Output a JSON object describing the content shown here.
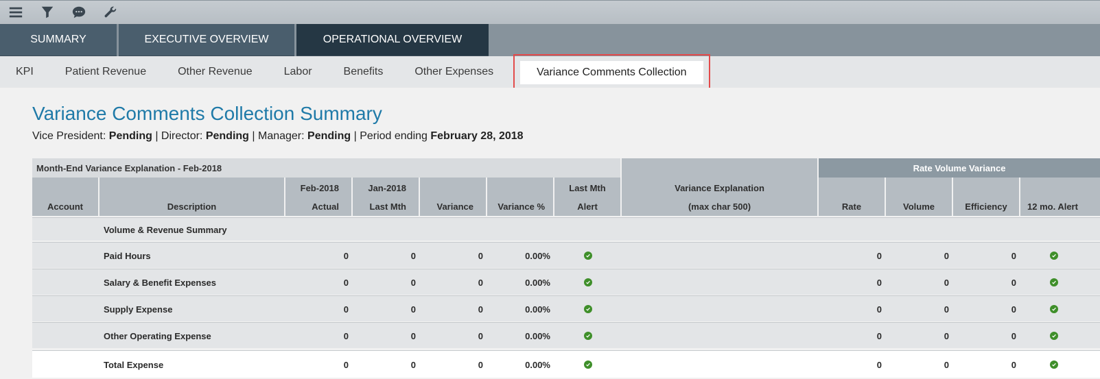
{
  "toolbar": {
    "icons": [
      "menu-icon",
      "filter-icon",
      "chat-icon",
      "wrench-icon"
    ]
  },
  "main_tabs": [
    {
      "label": "SUMMARY",
      "active": false
    },
    {
      "label": "EXECUTIVE OVERVIEW",
      "active": false
    },
    {
      "label": "OPERATIONAL OVERVIEW",
      "active": true
    }
  ],
  "sub_tabs": [
    {
      "label": "KPI"
    },
    {
      "label": "Patient Revenue"
    },
    {
      "label": "Other Revenue"
    },
    {
      "label": "Labor"
    },
    {
      "label": "Benefits"
    },
    {
      "label": "Other Expenses"
    },
    {
      "label": "Variance Comments Collection",
      "active": true
    }
  ],
  "page": {
    "title": "Variance Comments Collection Summary",
    "status": {
      "vp_label": "Vice President: ",
      "vp_value": "Pending",
      "sep1": " | Director: ",
      "director_value": "Pending",
      "sep2": " | Manager: ",
      "manager_value": "Pending",
      "sep3": " | Period ending ",
      "period_value": "February 28, 2018"
    }
  },
  "table": {
    "group_header": "Month-End Variance Explanation - Feb-2018",
    "rvv_header": "Rate Volume Variance",
    "columns": {
      "account": "Account",
      "description": "Description",
      "actual_l1": "Feb-2018",
      "actual_l2": "Actual",
      "lastmth_l1": "Jan-2018",
      "lastmth_l2": "Last Mth",
      "variance": "Variance",
      "variance_pct": "Variance %",
      "alert_l1": "Last Mth",
      "alert_l2": "Alert",
      "explanation_l1": "Variance Explanation",
      "explanation_l2": "(max char 500)",
      "rate": "Rate",
      "volume": "Volume",
      "efficiency": "Efficiency",
      "alert12": "12 mo. Alert"
    },
    "section_label": "Volume & Revenue Summary",
    "rows": [
      {
        "description": "Paid Hours",
        "actual": "0",
        "last_mth": "0",
        "variance": "0",
        "variance_pct": "0.00%",
        "rate": "0",
        "volume": "0",
        "efficiency": "0"
      },
      {
        "description": "Salary & Benefit Expenses",
        "actual": "0",
        "last_mth": "0",
        "variance": "0",
        "variance_pct": "0.00%",
        "rate": "0",
        "volume": "0",
        "efficiency": "0"
      },
      {
        "description": "Supply Expense",
        "actual": "0",
        "last_mth": "0",
        "variance": "0",
        "variance_pct": "0.00%",
        "rate": "0",
        "volume": "0",
        "efficiency": "0"
      },
      {
        "description": "Other Operating Expense",
        "actual": "0",
        "last_mth": "0",
        "variance": "0",
        "variance_pct": "0.00%",
        "rate": "0",
        "volume": "0",
        "efficiency": "0"
      },
      {
        "description": "Total Expense",
        "actual": "0",
        "last_mth": "0",
        "variance": "0",
        "variance_pct": "0.00%",
        "rate": "0",
        "volume": "0",
        "efficiency": "0"
      }
    ],
    "alert_icon": "check-circle-icon"
  }
}
